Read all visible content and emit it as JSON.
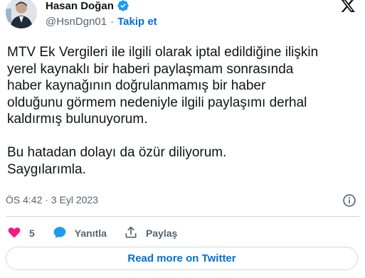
{
  "author": {
    "name": "Hasan Doğan",
    "handle": "@HsnDgn01",
    "separator": "·",
    "follow_label": "Takip et"
  },
  "tweet": {
    "text": "MTV Ek Vergileri ile ilgili olarak iptal edildiğine ilişkin\nyerel kaynaklı bir haberi paylaşmam sonrasında\nhaber kaynağının doğrulanmamış bir haber\nolduğunu görmem nedeniyle ilgili paylaşımı derhal\nkaldırmış bulunuyorum.\n\nBu hatadan dolayı da özür diliyorum.\nSaygılarımla.",
    "timestamp": "ÖS 4:42 · 3 Eyl 2023"
  },
  "actions": {
    "like_count": "5",
    "reply_label": "Yanıtla",
    "share_label": "Paylaş"
  },
  "read_more_label": "Read more on Twitter",
  "colors": {
    "accent": "#006fd6",
    "verified": "#1d9bf0",
    "like": "#f91880",
    "reply": "#1d9bf0",
    "muted": "#536471"
  },
  "icons": {
    "avatar": "avatar",
    "verified": "verified-badge-icon",
    "x_logo": "x-logo-icon",
    "info": "info-icon",
    "like": "heart-icon",
    "reply": "speech-bubble-icon",
    "share": "share-icon"
  }
}
